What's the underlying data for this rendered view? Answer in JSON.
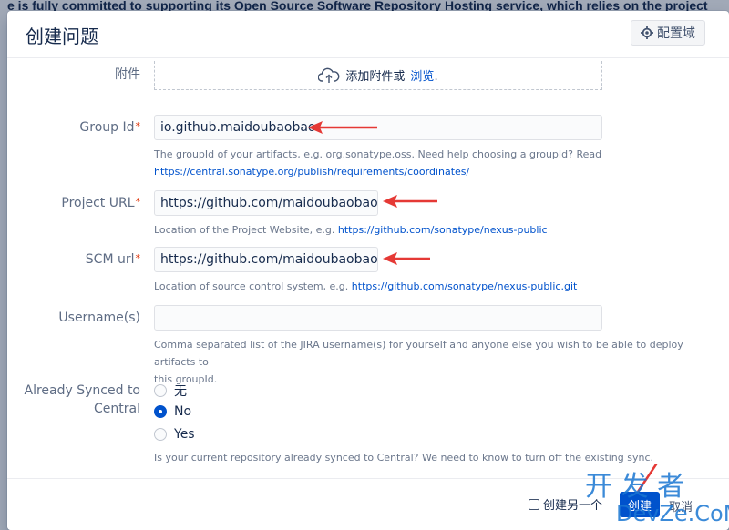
{
  "background": {
    "banner_text": "e is fully committed to supporting its Open Source Software Repository Hosting service, which relies on the project"
  },
  "modal": {
    "title": "创建问题",
    "config_button_label": "配置域"
  },
  "attachment": {
    "label": "附件",
    "drop_text": "添加附件或",
    "browse_link": "浏览",
    "suffix": "."
  },
  "fields": {
    "group_id": {
      "label": "Group Id",
      "required_mark": "*",
      "value": "io.github.maidoubaobao",
      "help_text": "The groupId of your artifacts, e.g. org.sonatype.oss. Need help choosing a groupId? Read",
      "help_link": "https://central.sonatype.org/publish/requirements/coordinates/"
    },
    "project_url": {
      "label": "Project URL",
      "required_mark": "*",
      "value": "https://github.com/maidoubaobao/ea",
      "help_text": "Location of the Project Website, e.g.",
      "help_link": "https://github.com/sonatype/nexus-public"
    },
    "scm_url": {
      "label": "SCM url",
      "required_mark": "*",
      "value": "https://github.com/maidoubaobao/ea",
      "help_text": "Location of source control system, e.g.",
      "help_link": "https://github.com/sonatype/nexus-public.git"
    },
    "usernames": {
      "label": "Username(s)",
      "value": "",
      "help_line1": "Comma separated list of the JIRA username(s) for yourself and anyone else you wish to be able to deploy artifacts to",
      "help_line2": "this groupId."
    },
    "already_synced": {
      "label_line1": "Already Synced to",
      "label_line2": "Central",
      "options": [
        "无",
        "No",
        "Yes"
      ],
      "selected": "No",
      "help_text": "Is your current repository already synced to Central? We need to know to turn off the existing sync."
    }
  },
  "footer": {
    "create_another_label": "创建另一个",
    "create_button_label": "创建",
    "cancel_label": "取消"
  },
  "watermark": {
    "text_cn": "开 发 者",
    "text_en": "DevZe.CoM"
  },
  "colors": {
    "primary": "#0052cc",
    "required": "#de350b",
    "annotation_arrow": "#e53935"
  }
}
